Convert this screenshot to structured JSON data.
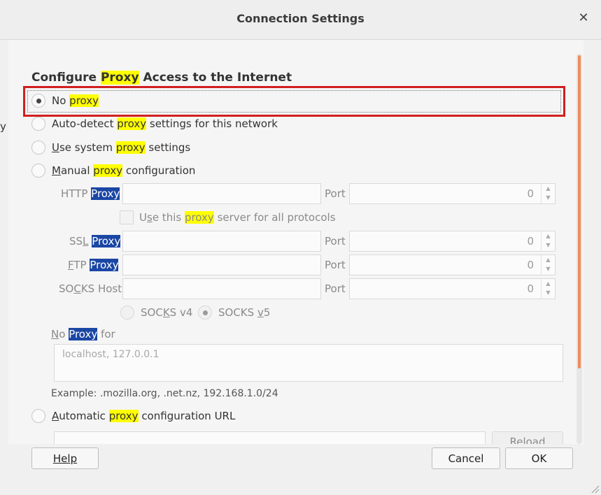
{
  "backdrop": {
    "fragment_text": "y"
  },
  "dialog": {
    "title": "Connection Settings",
    "close_glyph": "✕"
  },
  "section": {
    "heading_pre": "Configure ",
    "heading_hl": "Proxy",
    "heading_post": " Access to the Internet"
  },
  "options": {
    "no_proxy": {
      "pre": "No ",
      "hl": "proxy",
      "checked": true
    },
    "auto_detect": {
      "pre": "Auto-detect ",
      "hl": "proxy",
      "post": " settings for this network"
    },
    "system": {
      "ul": "U",
      "pre": "se system ",
      "hl": "proxy",
      "post": " settings"
    },
    "manual": {
      "ul": "M",
      "pre": "anual ",
      "hl": "proxy",
      "post": " configuration"
    },
    "automatic_url": {
      "ul": "A",
      "pre": "utomatic ",
      "hl": "proxy",
      "post": " configuration URL"
    }
  },
  "manual": {
    "http": {
      "label_pre": "HTTP ",
      "label_sel": "Proxy",
      "value": "",
      "port_label": "Port",
      "port": "0"
    },
    "use_all": {
      "ul": "s",
      "pre_u": "U",
      "pre": "e this ",
      "hl": "proxy",
      "post": " server for all protocols"
    },
    "ssl": {
      "label_pre": "SS",
      "label_ul": "L",
      "label_sel": "Proxy",
      "value": "",
      "port_label": "Port",
      "port": "0"
    },
    "ftp": {
      "label_ul": "F",
      "label_pre": "TP ",
      "label_sel": "Proxy",
      "value": "",
      "port_label": "Port",
      "port": "0"
    },
    "socks": {
      "label_pre": "SO",
      "label_ul": "C",
      "label_post": "KS Host",
      "value": "",
      "port_label": "Port",
      "port": "0"
    },
    "socks_v4": {
      "pre": "SOC",
      "ul": "K",
      "post": "S v4",
      "checked": false
    },
    "socks_v5": {
      "pre": "SOCKS ",
      "ul": "v",
      "post": "5",
      "checked": true
    },
    "no_proxy_for": {
      "ul": "N",
      "pre": "o ",
      "sel": "Proxy",
      "post": " for"
    },
    "no_proxy_placeholder": "localhost, 127.0.0.1",
    "example": "Example: .mozilla.org, .net.nz, 192.168.1.0/24"
  },
  "auto_url": {
    "value": "",
    "reload_label": "Reload"
  },
  "buttons": {
    "help": "Help",
    "cancel": "Cancel",
    "ok": "OK"
  },
  "colors": {
    "highlight": "#ffff00",
    "selection": "#1a46a4",
    "focus_box": "#d21f1f",
    "scroll_thumb": "#ef8b5a"
  },
  "icons": {
    "close": "close-icon",
    "resize": "resize-grip-icon"
  }
}
